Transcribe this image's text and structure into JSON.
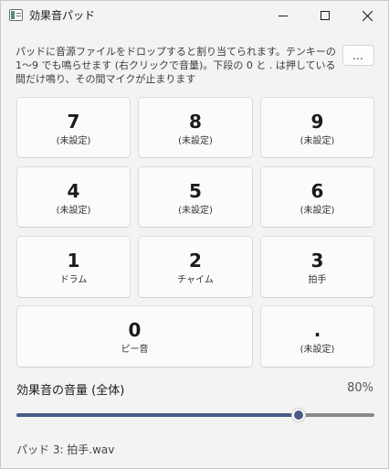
{
  "window": {
    "title": "効果音パッド",
    "icon": "app-icon",
    "controls": [
      "minimize-icon",
      "maximize-icon",
      "close-icon"
    ]
  },
  "description": "パッドに音源ファイルをドロップすると割り当てられます。テンキーの 1〜9 でも鳴らせます (右クリックで音量)。下段の 0 と . は押している間だけ鳴り、その間マイクが止まります",
  "more_button": "…",
  "pads": [
    {
      "key": "7",
      "label": "(未設定)"
    },
    {
      "key": "8",
      "label": "(未設定)"
    },
    {
      "key": "9",
      "label": "(未設定)"
    },
    {
      "key": "4",
      "label": "(未設定)"
    },
    {
      "key": "5",
      "label": "(未設定)"
    },
    {
      "key": "6",
      "label": "(未設定)"
    },
    {
      "key": "1",
      "label": "ドラム"
    },
    {
      "key": "2",
      "label": "チャイム"
    },
    {
      "key": "3",
      "label": "拍手"
    },
    {
      "key": "0",
      "label": "ピー音"
    },
    {
      "key": ".",
      "label": "(未設定)"
    }
  ],
  "volume": {
    "label": "効果音の音量 (全体)",
    "value_text": "80%",
    "value": 0.8,
    "fill_color": "#4a5a88"
  },
  "status": "パッド 3: 拍手.wav"
}
